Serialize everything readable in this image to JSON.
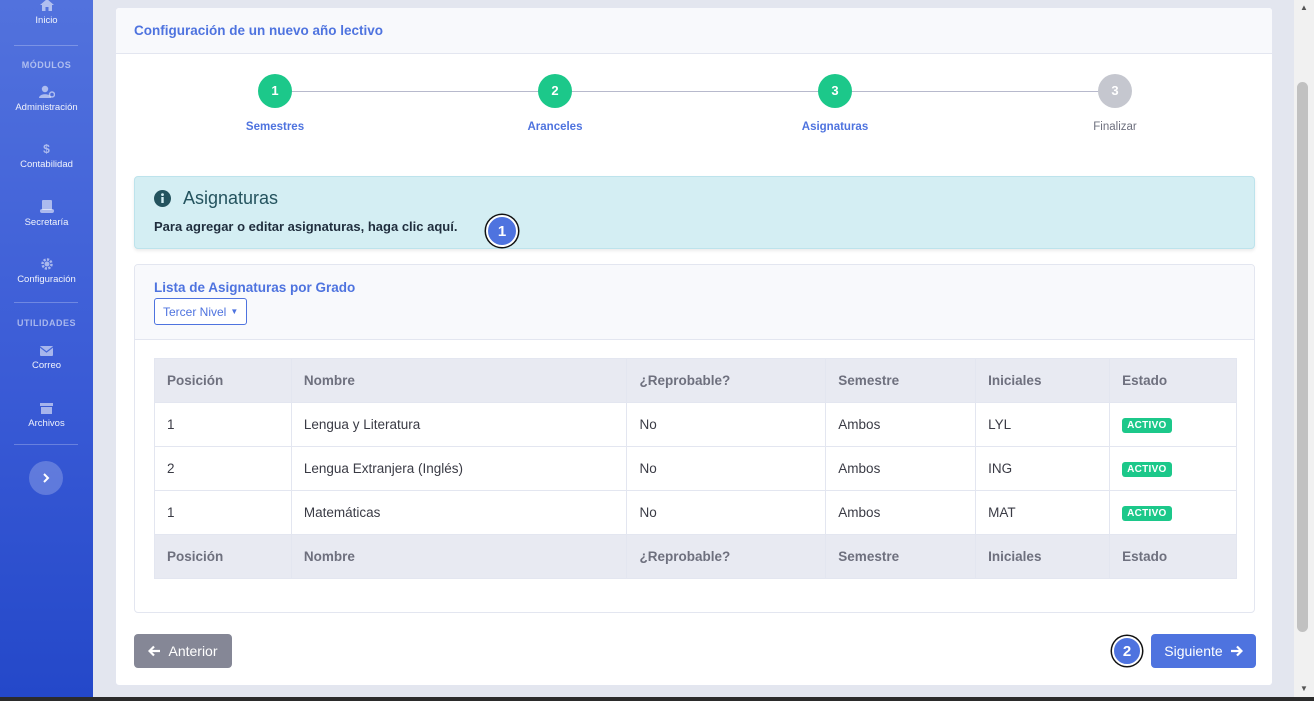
{
  "sidebar": {
    "home": "Inicio",
    "heading_modules": "MÓDULOS",
    "items": [
      {
        "label": "Administración",
        "icon": "users-cog-icon"
      },
      {
        "label": "Contabilidad",
        "icon": "dollar-icon"
      },
      {
        "label": "Secretaría",
        "icon": "scroll-icon"
      },
      {
        "label": "Configuración",
        "icon": "gear-icon"
      }
    ],
    "heading_utilities": "UTILIDADES",
    "utilities": [
      {
        "label": "Correo",
        "icon": "envelope-icon"
      },
      {
        "label": "Archivos",
        "icon": "archive-icon"
      }
    ]
  },
  "page": {
    "title": "Configuración de un nuevo año lectivo"
  },
  "stepper": [
    {
      "number": "1",
      "label": "Semestres",
      "state": "done"
    },
    {
      "number": "2",
      "label": "Aranceles",
      "state": "done"
    },
    {
      "number": "3",
      "label": "Asignaturas",
      "state": "done"
    },
    {
      "number": "3",
      "label": "Finalizar",
      "state": "pending"
    }
  ],
  "alert": {
    "title": "Asignaturas",
    "text": "Para agregar o editar asignaturas, haga clic aquí.",
    "marker": "1"
  },
  "subjects": {
    "title": "Lista de Asignaturas por Grado",
    "grade_selected": "Tercer Nivel",
    "columns": [
      "Posición",
      "Nombre",
      "¿Reprobable?",
      "Semestre",
      "Iniciales",
      "Estado"
    ],
    "rows": [
      {
        "position": "1",
        "name": "Lengua y Literatura",
        "failable": "No",
        "semester": "Ambos",
        "initials": "LYL",
        "status": "ACTIVO"
      },
      {
        "position": "2",
        "name": "Lengua Extranjera (Inglés)",
        "failable": "No",
        "semester": "Ambos",
        "initials": "ING",
        "status": "ACTIVO"
      },
      {
        "position": "1",
        "name": "Matemáticas",
        "failable": "No",
        "semester": "Ambos",
        "initials": "MAT",
        "status": "ACTIVO"
      }
    ]
  },
  "footer": {
    "prev": "Anterior",
    "next": "Siguiente",
    "marker": "2"
  },
  "colors": {
    "primary": "#4e73df",
    "success": "#1cc88a",
    "secondary": "#858796",
    "info_bg": "#d4eef3"
  }
}
